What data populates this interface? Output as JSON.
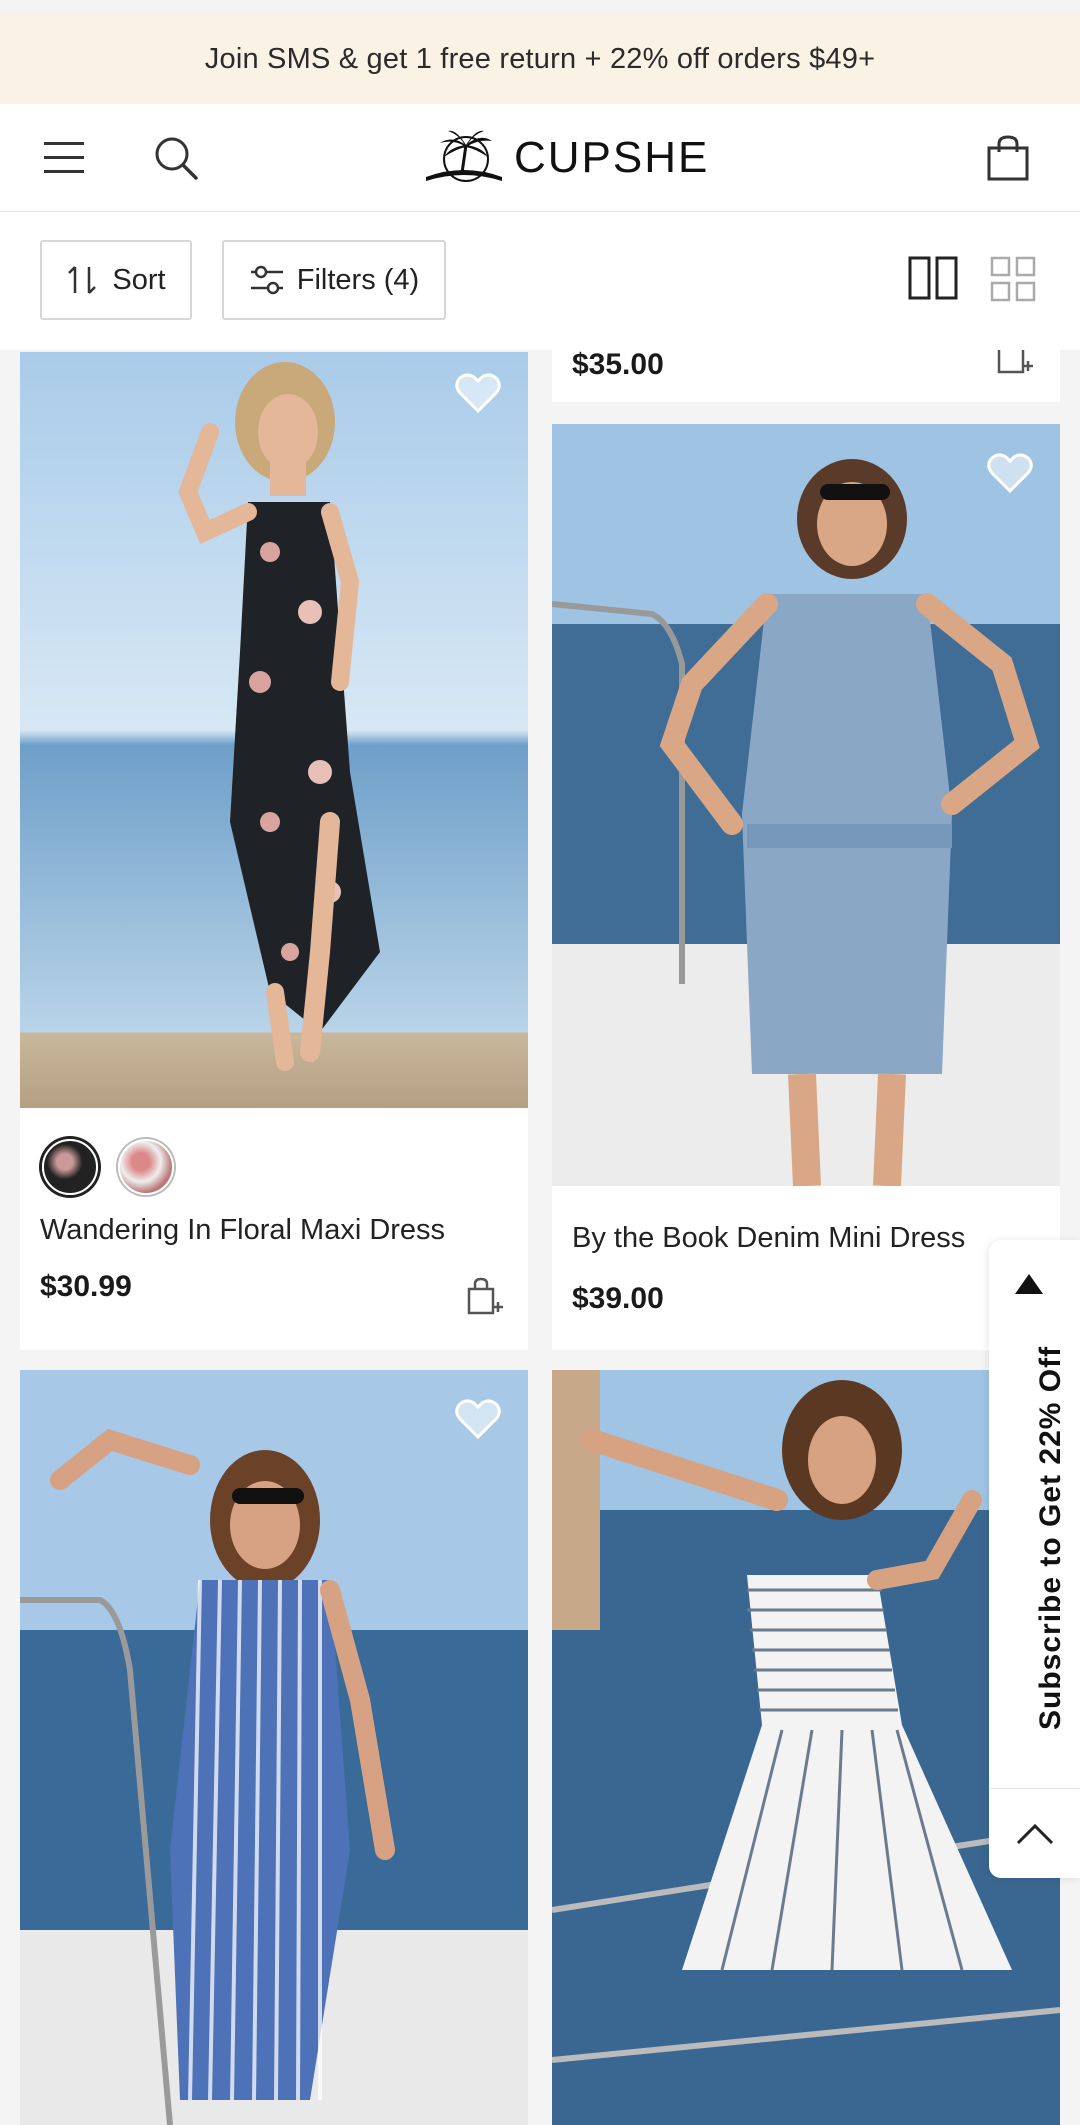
{
  "promo_banner": {
    "text": "Join SMS & get 1 free return + 22% off orders $49+"
  },
  "header": {
    "brand": "CUPSHE",
    "icons": [
      "menu-icon",
      "search-icon",
      "palm-logo-icon",
      "shopping-bag-icon"
    ]
  },
  "toolbar": {
    "sort_label": "Sort",
    "filters_label": "Filters (4)",
    "view_modes": [
      "two-column",
      "four-grid"
    ],
    "active_view": "two-column"
  },
  "partial_card": {
    "price": "$35.00"
  },
  "products": [
    {
      "name": "Wandering In Floral Maxi Dress",
      "price": "$30.99",
      "swatches": [
        "dark-floral",
        "light-floral"
      ],
      "selected_swatch": 0,
      "wishlisted": false
    },
    {
      "name": "By the Book Denim Mini Dress",
      "price": "$39.00",
      "wishlisted": false
    },
    {
      "name": "",
      "price": "",
      "wishlisted": false
    },
    {
      "name": "",
      "price": ""
    }
  ],
  "side_tab": {
    "text": "Subscribe to Get 22% Off"
  },
  "colors": {
    "promo_bg": "#fbf2e6",
    "text": "#222222",
    "page_bg": "#f4f4f4"
  }
}
